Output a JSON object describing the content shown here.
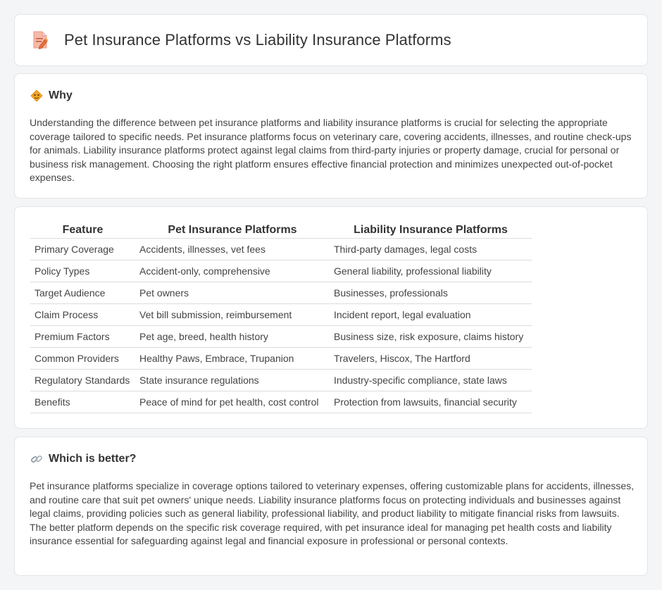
{
  "header": {
    "title": "Pet Insurance Platforms vs Liability Insurance Platforms",
    "icon": "document-edit-icon"
  },
  "why": {
    "title": "Why",
    "icon": "warning-diamond-icon",
    "text": "Understanding the difference between pet insurance platforms and liability insurance platforms is crucial for selecting the appropriate coverage tailored to specific needs. Pet insurance platforms focus on veterinary care, covering accidents, illnesses, and routine check-ups for animals. Liability insurance platforms protect against legal claims from third-party injuries or property damage, crucial for personal or business risk management. Choosing the right platform ensures effective financial protection and minimizes unexpected out-of-pocket expenses."
  },
  "comparison": {
    "headers": [
      "Feature",
      "Pet Insurance Platforms",
      "Liability Insurance Platforms"
    ],
    "rows": [
      [
        "Primary Coverage",
        "Accidents, illnesses, vet fees",
        "Third-party damages, legal costs"
      ],
      [
        "Policy Types",
        "Accident-only, comprehensive",
        "General liability, professional liability"
      ],
      [
        "Target Audience",
        "Pet owners",
        "Businesses, professionals"
      ],
      [
        "Claim Process",
        "Vet bill submission, reimbursement",
        "Incident report, legal evaluation"
      ],
      [
        "Premium Factors",
        "Pet age, breed, health history",
        "Business size, risk exposure, claims history"
      ],
      [
        "Common Providers",
        "Healthy Paws, Embrace, Trupanion",
        "Travelers, Hiscox, The Hartford"
      ],
      [
        "Regulatory Standards",
        "State insurance regulations",
        "Industry-specific compliance, state laws"
      ],
      [
        "Benefits",
        "Peace of mind for pet health, cost control",
        "Protection from lawsuits, financial security"
      ]
    ]
  },
  "better": {
    "title": "Which is better?",
    "icon": "link-icon",
    "text": "Pet insurance platforms specialize in coverage options tailored to veterinary expenses, offering customizable plans for accidents, illnesses, and routine care that suit pet owners' unique needs. Liability insurance platforms focus on protecting individuals and businesses against legal claims, providing policies such as general liability, professional liability, and product liability to mitigate financial risks from lawsuits. The better platform depends on the specific risk coverage required, with pet insurance ideal for managing pet health costs and liability insurance essential for safeguarding against legal and financial exposure in professional or personal contexts."
  }
}
